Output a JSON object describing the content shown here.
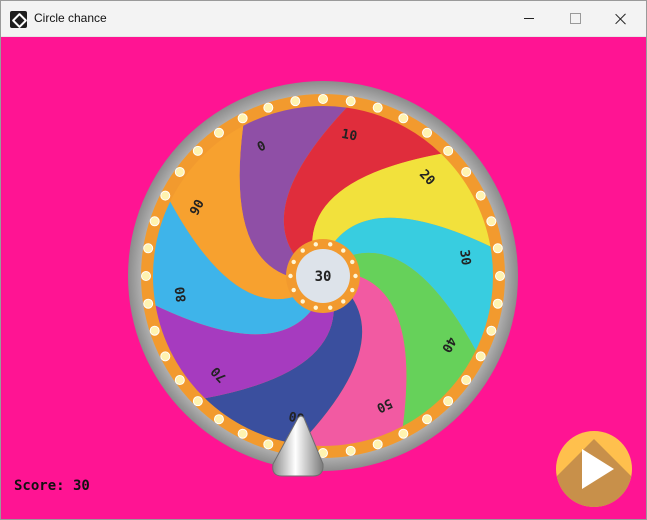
{
  "window": {
    "title": "Circle chance",
    "app_icon": "game-logo-icon"
  },
  "game": {
    "background_color": "#ff1493",
    "wheel": {
      "segments": [
        {
          "label": "0",
          "color": "#8f4fa6"
        },
        {
          "label": "10",
          "color": "#e02d3c"
        },
        {
          "label": "20",
          "color": "#f2e13c"
        },
        {
          "label": "30",
          "color": "#38cde0"
        },
        {
          "label": "40",
          "color": "#66d15a"
        },
        {
          "label": "50",
          "color": "#f25aa2"
        },
        {
          "label": "60",
          "color": "#3a4f9e"
        },
        {
          "label": "70",
          "color": "#a63bbf"
        },
        {
          "label": "80",
          "color": "#3eb4ea"
        },
        {
          "label": "90",
          "color": "#f7a12f"
        }
      ],
      "center_value": "30",
      "rim_color": "#f29a2e",
      "bulb_color": "#fff3b0"
    },
    "pointer_icon": "silver-triangle-pointer",
    "score_text": "Score: 30",
    "play_button_icon": "play-icon",
    "play_button_color": "#ffc04d"
  }
}
